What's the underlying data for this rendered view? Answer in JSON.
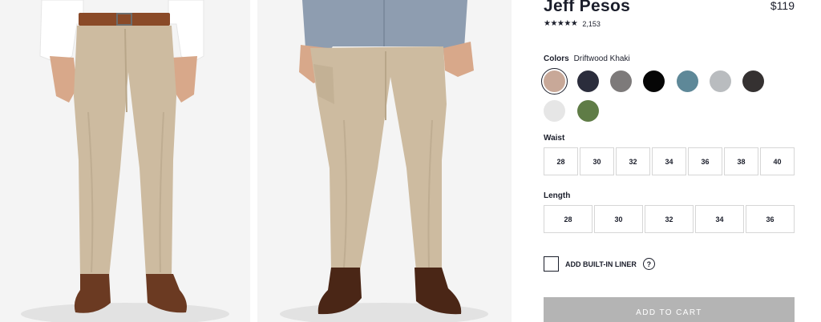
{
  "product": {
    "title": "Jeff Pesos",
    "price": "$119",
    "rating_stars": "★★★★★",
    "rating_value": 4.5,
    "review_count": "2,153"
  },
  "colors": {
    "label": "Colors",
    "selected_name": "Driftwood Khaki",
    "swatches": [
      {
        "name": "driftwood-khaki",
        "hex": "#c8a898",
        "selected": true
      },
      {
        "name": "navy",
        "hex": "#2b2d3c"
      },
      {
        "name": "gray",
        "hex": "#7d7a7a"
      },
      {
        "name": "black",
        "hex": "#060606"
      },
      {
        "name": "steel-blue",
        "hex": "#5e8898"
      },
      {
        "name": "light-gray",
        "hex": "#b9bcbf"
      },
      {
        "name": "charcoal",
        "hex": "#353131"
      },
      {
        "name": "white",
        "hex": "#e6e6e6"
      },
      {
        "name": "olive",
        "hex": "#5f7c46"
      }
    ]
  },
  "waist": {
    "label": "Waist",
    "options": [
      "28",
      "30",
      "32",
      "34",
      "36",
      "38",
      "40"
    ]
  },
  "length": {
    "label": "Length",
    "options": [
      "28",
      "30",
      "32",
      "34",
      "36"
    ]
  },
  "liner": {
    "label": "ADD BUILT-IN LINER",
    "help": "?"
  },
  "cart": {
    "label": "ADD TO CART"
  },
  "photos": [
    {
      "alt": "Model front view wearing khaki chinos with brown belt and white shirt"
    },
    {
      "alt": "Model wearing khaki chinos with denim shirt, pulling fabric to show stretch"
    }
  ]
}
